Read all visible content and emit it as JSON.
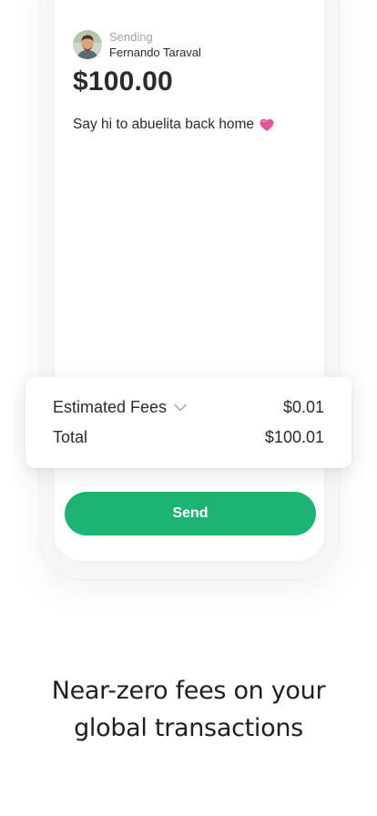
{
  "transfer": {
    "sending_label": "Sending",
    "recipient_name": "Fernando Taraval",
    "amount": "$100.00",
    "message": "Say hi to abuelita back home",
    "message_emoji": "heart-icon"
  },
  "fees": {
    "estimated_label": "Estimated Fees",
    "estimated_value": "$0.01",
    "total_label": "Total",
    "total_value": "$100.01"
  },
  "actions": {
    "send_label": "Send"
  },
  "marketing": {
    "headline_line1": "Near-zero fees on your",
    "headline_line2": "global transactions"
  },
  "colors": {
    "accent": "#1db372",
    "heart": "#e8559c",
    "text": "#2b2b2b",
    "muted": "#a3a3a3"
  }
}
